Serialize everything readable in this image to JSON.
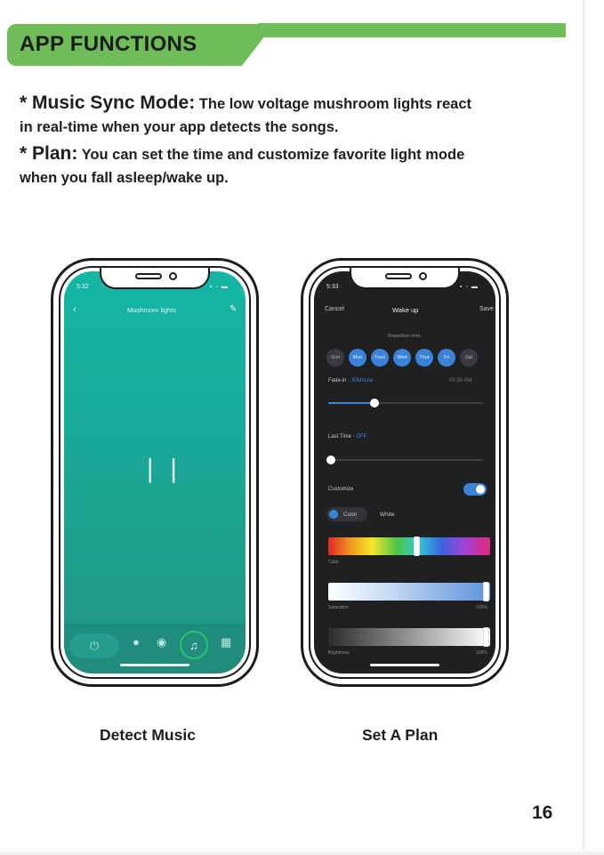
{
  "header": {
    "title": "APP FUNCTIONS"
  },
  "paragraphs": [
    {
      "key": "* Music Sync Mode:",
      "line1": " The low voltage mushroom lights react",
      "line2": "in real-time when your app detects the songs."
    },
    {
      "key": "* Plan:",
      "line1": " You can set the time and customize favorite light mode",
      "line2": "when you fall asleep/wake up."
    }
  ],
  "phone1": {
    "time": "5:32",
    "title": "Mushroom lights",
    "pause_glyph": "| |",
    "caption": "Detect Music",
    "icons": [
      "back-chevron-icon",
      "edit-icon",
      "pause-icon",
      "power-icon",
      "bulb-icon",
      "palette-icon",
      "music-icon",
      "grid-icon"
    ]
  },
  "phone2": {
    "time": "5:33",
    "cancel": "Cancel",
    "title": "Wake up",
    "save": "Save",
    "repetition_label": "Repetition time",
    "days": [
      {
        "label": "Sun",
        "on": false
      },
      {
        "label": "Mon",
        "on": true
      },
      {
        "label": "Tues",
        "on": true
      },
      {
        "label": "Wed",
        "on": true
      },
      {
        "label": "Thur",
        "on": true
      },
      {
        "label": "Fri",
        "on": true
      },
      {
        "label": "Sat",
        "on": false
      }
    ],
    "fade_label": "Fade-in",
    "fade_value": "30Minute",
    "alarm_time": "05:30 AM",
    "fade_fraction": 0.3,
    "last_label": "Last Time",
    "last_value": "OFF",
    "customize": "Customize",
    "customize_on": true,
    "color_chip": "Color",
    "white_chip": "White",
    "color_label": "Color",
    "saturation_label": "Saturation",
    "saturation_value": "100%",
    "brightness_label": "Brightness",
    "brightness_value": "100%",
    "caption": "Set A Plan"
  },
  "page_number": "16",
  "colors": {
    "header_green": "#6ebd58",
    "screen_teal": "#14b6a6",
    "accent_blue": "#3b82d9"
  }
}
